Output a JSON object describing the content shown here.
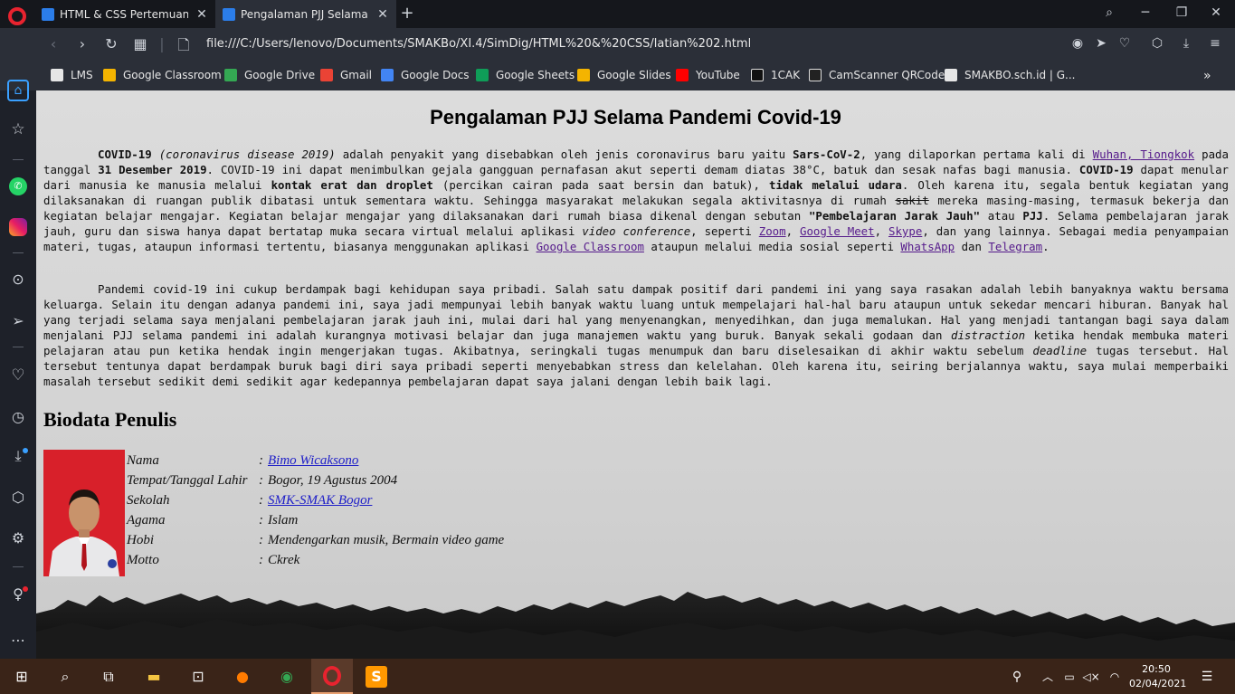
{
  "tabs": [
    {
      "title": "HTML & CSS Pertemuan 2",
      "active": false
    },
    {
      "title": "Pengalaman PJJ Selama Pandemi Covid-19",
      "active": true
    }
  ],
  "address": {
    "url": "file:///C:/Users/lenovo/Documents/SMAKBo/XI.4/SimDig/HTML%20&%20CSS/latian%202.html"
  },
  "bookmarks": [
    {
      "label": "LMS",
      "icon": "page-icon",
      "color": "#e6e6e6"
    },
    {
      "label": "Google Classroom",
      "icon": "classroom-icon",
      "color": "#f4b400"
    },
    {
      "label": "Google Drive",
      "icon": "drive-icon",
      "color": "#34a853"
    },
    {
      "label": "Gmail",
      "icon": "gmail-icon",
      "color": "#ea4335"
    },
    {
      "label": "Google Docs",
      "icon": "docs-icon",
      "color": "#4285f4"
    },
    {
      "label": "Google Sheets",
      "icon": "sheets-icon",
      "color": "#0f9d58"
    },
    {
      "label": "Google Slides",
      "icon": "slides-icon",
      "color": "#f4b400"
    },
    {
      "label": "YouTube",
      "icon": "youtube-icon",
      "color": "#ff0000"
    },
    {
      "label": "1CAK",
      "icon": "1cak-icon",
      "color": "#111111"
    },
    {
      "label": "CamScanner QRCode",
      "icon": "camscanner-icon",
      "color": "#222222"
    },
    {
      "label": "SMAKBO.sch.id | G...",
      "icon": "page-icon",
      "color": "#e6e6e6"
    }
  ],
  "page": {
    "title": "Pengalaman PJJ Selama Pandemi Covid-19",
    "p1": [
      {
        "t": "b",
        "v": "COVID-19"
      },
      {
        "t": "s",
        "v": " "
      },
      {
        "t": "i",
        "v": "(coronavirus disease 2019)"
      },
      {
        "t": "s",
        "v": " adalah penyakit yang disebabkan oleh jenis coronavirus baru yaitu "
      },
      {
        "t": "b",
        "v": "Sars-CoV-2"
      },
      {
        "t": "s",
        "v": ", yang dilaporkan pertama kali di "
      },
      {
        "t": "a",
        "v": "Wuhan, Tiongkok"
      },
      {
        "t": "s",
        "v": " pada tanggal "
      },
      {
        "t": "b",
        "v": "31 Desember 2019"
      },
      {
        "t": "s",
        "v": ". COVID-19 ini dapat menimbulkan gejala gangguan pernafasan akut seperti demam diatas 38°C, batuk dan sesak nafas bagi manusia. "
      },
      {
        "t": "b",
        "v": "COVID-19"
      },
      {
        "t": "s",
        "v": " dapat menular dari manusia ke manusia melalui "
      },
      {
        "t": "b",
        "v": "kontak erat dan droplet"
      },
      {
        "t": "s",
        "v": " (percikan cairan pada saat bersin dan batuk), "
      },
      {
        "t": "b",
        "v": "tidak melalui udara"
      },
      {
        "t": "s",
        "v": ". Oleh karena itu, segala bentuk kegiatan yang dilaksanakan di ruangan publik dibatasi untuk sementara waktu. Sehingga masyarakat melakukan segala aktivitasnya di rumah "
      },
      {
        "t": "del",
        "v": "sakit"
      },
      {
        "t": "s",
        "v": " mereka masing-masing, termasuk bekerja dan kegiatan belajar mengajar. Kegiatan belajar mengajar yang dilaksanakan dari rumah biasa dikenal dengan sebutan "
      },
      {
        "t": "b",
        "v": "\"Pembelajaran Jarak Jauh\""
      },
      {
        "t": "s",
        "v": " atau "
      },
      {
        "t": "b",
        "v": "PJJ"
      },
      {
        "t": "s",
        "v": ". Selama pembelajaran jarak jauh, guru dan siswa hanya dapat bertatap muka secara virtual melalui aplikasi "
      },
      {
        "t": "i",
        "v": "video conference"
      },
      {
        "t": "s",
        "v": ", seperti "
      },
      {
        "t": "a",
        "v": "Zoom"
      },
      {
        "t": "s",
        "v": ", "
      },
      {
        "t": "a",
        "v": "Google Meet"
      },
      {
        "t": "s",
        "v": ", "
      },
      {
        "t": "a",
        "v": "Skype"
      },
      {
        "t": "s",
        "v": ", dan yang lainnya. Sebagai media penyampaian materi, tugas, ataupun informasi tertentu, biasanya menggunakan aplikasi "
      },
      {
        "t": "a",
        "v": "Google Classroom"
      },
      {
        "t": "s",
        "v": " ataupun melalui media sosial seperti "
      },
      {
        "t": "a",
        "v": "WhatsApp"
      },
      {
        "t": "s",
        "v": " dan "
      },
      {
        "t": "a",
        "v": "Telegram"
      },
      {
        "t": "s",
        "v": "."
      }
    ],
    "p2": [
      {
        "t": "s",
        "v": "Pandemi covid-19 ini cukup berdampak bagi kehidupan saya pribadi. Salah satu dampak positif dari pandemi ini yang saya rasakan adalah lebih banyaknya waktu bersama keluarga. Selain itu dengan adanya pandemi ini, saya jadi mempunyai lebih banyak waktu luang untuk mempelajari hal-hal baru ataupun untuk sekedar mencari hiburan. Banyak hal yang terjadi selama saya menjalani pembelajaran jarak jauh ini, mulai dari hal yang menyenangkan, menyedihkan, dan juga memalukan. Hal yang menjadi tantangan bagi saya dalam menjalani PJJ selama pandemi ini adalah kurangnya motivasi belajar dan juga manajemen waktu yang buruk. Banyak sekali godaan dan "
      },
      {
        "t": "i",
        "v": "distraction"
      },
      {
        "t": "s",
        "v": " ketika hendak membuka materi pelajaran atau pun ketika hendak ingin mengerjakan tugas. Akibatnya, seringkali tugas menumpuk dan baru diselesaikan di akhir waktu sebelum "
      },
      {
        "t": "i",
        "v": "deadline"
      },
      {
        "t": "s",
        "v": " tugas tersebut. Hal tersebut tentunya dapat berdampak buruk bagi diri saya pribadi seperti menyebabkan stress dan kelelahan. Oleh karena itu, seiring berjalannya waktu, saya mulai memperbaiki masalah tersebut sedikit demi sedikit agar kedepannya pembelajaran dapat saya jalani dengan lebih baik lagi."
      }
    ],
    "bio_heading": "Biodata Penulis",
    "bio": [
      {
        "label": "Nama",
        "value": "Bimo Wicaksono",
        "link": true
      },
      {
        "label": "Tempat/Tanggal Lahir",
        "value": "Bogor, 19 Agustus 2004",
        "link": false
      },
      {
        "label": "Sekolah",
        "value": "SMK-SMAK Bogor",
        "link": true
      },
      {
        "label": "Agama",
        "value": "Islam",
        "link": false
      },
      {
        "label": "Hobi",
        "value": "Mendengarkan musik, Bermain video game",
        "link": false
      },
      {
        "label": "Motto",
        "value": "Ckrek",
        "link": false
      }
    ],
    "separator": ":"
  },
  "taskbar": {
    "time": "20:50",
    "date": "02/04/2021"
  },
  "colors": {
    "accent_red": "#e8232f",
    "link_visited": "#551a8b",
    "link_blue": "#2020c8"
  }
}
